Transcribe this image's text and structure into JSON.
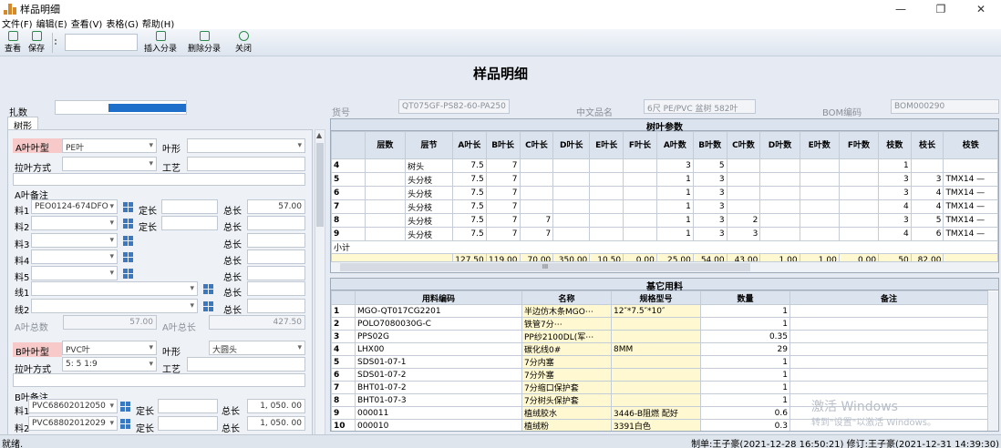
{
  "window": {
    "title": "样品明细",
    "min": "—",
    "max": "❐",
    "close": "✕"
  },
  "menu": [
    "文件(F)",
    "编辑(E)",
    "查看(V)",
    "表格(G)",
    "帮助(H)"
  ],
  "toolbar": {
    "view": "查看",
    "save": "保存",
    "insert": "插入分录",
    "delete": "删除分录",
    "close": "关闭"
  },
  "page_title": "样品明细",
  "header": {
    "bundle_label": "扎数",
    "item_no_label": "货号",
    "item_no": "QT075GF-PS82-60-PA250",
    "cn_name_label": "中文品名",
    "cn_name": "6尺 PE/PVC 盆树 582叶",
    "bom_label": "BOM编码",
    "bom": "BOM000290"
  },
  "left": {
    "tab": "树形",
    "a_type_label": "A叶叶型",
    "a_type": "PE叶",
    "shape_label": "叶形",
    "pull_label": "拉叶方式",
    "craft_label": "工艺",
    "a_note_label": "A叶备注",
    "mat1_label": "料1",
    "mat1": "PEO0124-674DFO",
    "fix_label": "定长",
    "total_label": "总长",
    "mat1_total": "57.00",
    "mat2_label": "料2",
    "mat3_label": "料3",
    "mat4_label": "料4",
    "mat5_label": "料5",
    "wire1_label": "线1",
    "wire2_label": "线2",
    "a_sum_label": "A叶总数",
    "a_sum": "57.00",
    "a_total_label": "A叶总长",
    "a_total": "427.50",
    "b_type_label": "B叶叶型",
    "b_type": "PVC叶",
    "b_shape_label": "叶形",
    "b_shape": "大圆头",
    "b_pull_label": "拉叶方式",
    "b_pull": "5: 5   1:9",
    "b_craft_label": "工艺",
    "b_note_label": "B叶备注",
    "b_mat1_label": "料1",
    "b_mat1": "PVC68602012050",
    "b_fix1_label": "定长",
    "b_total1_label": "总长",
    "b_total1": "1, 050. 00",
    "b_mat2_label": "料2",
    "b_mat2": "PVC68802012029",
    "b_fix2_label": "定长",
    "b_total2_label": "总长",
    "b_total2": "1, 050. 00"
  },
  "tree_params": {
    "caption": "树叶参数",
    "headers": [
      "层数",
      "层节",
      "A叶长",
      "B叶长",
      "C叶长",
      "D叶长",
      "E叶长",
      "F叶长",
      "A叶数",
      "B叶数",
      "C叶数",
      "D叶数",
      "E叶数",
      "F叶数",
      "枝数",
      "枝长",
      "枝铁"
    ],
    "rows": [
      {
        "rn": "4",
        "node": "树头",
        "a": "7.5",
        "b": "7",
        "c": "",
        "an": "3",
        "bn": "5",
        "cn": "",
        "zs": "1",
        "zc": "",
        "zt": ""
      },
      {
        "rn": "5",
        "node": "头分枝",
        "a": "7.5",
        "b": "7",
        "c": "",
        "an": "1",
        "bn": "3",
        "cn": "",
        "zs": "3",
        "zc": "3",
        "zt": "TMX14 —"
      },
      {
        "rn": "6",
        "node": "头分枝",
        "a": "7.5",
        "b": "7",
        "c": "",
        "an": "1",
        "bn": "3",
        "cn": "",
        "zs": "3",
        "zc": "4",
        "zt": "TMX14 —"
      },
      {
        "rn": "7",
        "node": "头分枝",
        "a": "7.5",
        "b": "7",
        "c": "",
        "an": "1",
        "bn": "3",
        "cn": "",
        "zs": "4",
        "zc": "4",
        "zt": "TMX14 —"
      },
      {
        "rn": "8",
        "node": "头分枝",
        "a": "7.5",
        "b": "7",
        "c": "7",
        "an": "1",
        "bn": "3",
        "cn": "2",
        "zs": "3",
        "zc": "5",
        "zt": "TMX14 —"
      },
      {
        "rn": "9",
        "node": "头分枝",
        "a": "7.5",
        "b": "7",
        "c": "7",
        "an": "1",
        "bn": "3",
        "cn": "3",
        "zs": "4",
        "zc": "6",
        "zt": "TMX14 —"
      }
    ],
    "subtotal_label": "小计",
    "totals": [
      "127.50",
      "119.00",
      "70.00",
      "350.00",
      "10.50",
      "0.00",
      "25.00",
      "54.00",
      "43.00",
      "1.00",
      "1.00",
      "0.00",
      "50",
      "82.00"
    ]
  },
  "base_materials": {
    "caption": "基它用料",
    "headers": [
      "用料编码",
      "名称",
      "规格型号",
      "数量",
      "备注"
    ],
    "rows": [
      {
        "rn": "1",
        "code": "MGO-QT017CG2201",
        "name": "半边仿木条MGO⋯",
        "spec": "12″*7.5″*10″",
        "qty": "1"
      },
      {
        "rn": "2",
        "code": "POLO7080030G-C",
        "name": "铁管7分⋯",
        "spec": "",
        "qty": "1"
      },
      {
        "rn": "3",
        "code": "PPS02G",
        "name": "PP纱2100DL(军⋯",
        "spec": "",
        "qty": "0.35"
      },
      {
        "rn": "4",
        "code": "LHX00",
        "name": "碳化线0#",
        "spec": "8MM",
        "qty": "29"
      },
      {
        "rn": "5",
        "code": "SDS01-07-1",
        "name": "7分内塞",
        "spec": "",
        "qty": "1"
      },
      {
        "rn": "6",
        "code": "SDS01-07-2",
        "name": "7分外塞",
        "spec": "",
        "qty": "1"
      },
      {
        "rn": "7",
        "code": "BHT01-07-2",
        "name": "7分缩口保护套",
        "spec": "",
        "qty": "1"
      },
      {
        "rn": "8",
        "code": "BHT01-07-3",
        "name": "7分树头保护套",
        "spec": "",
        "qty": "1"
      },
      {
        "rn": "9",
        "code": "000011",
        "name": "植绒胶水",
        "spec": "3446-B阻燃 配好",
        "qty": "0.6"
      },
      {
        "rn": "10",
        "code": "000010",
        "name": "植绒粉",
        "spec": "3391白色",
        "qty": "0.3"
      }
    ]
  },
  "watermark": {
    "line1": "激活 Windows",
    "line2": "转到\"设置\"以激活 Windows。"
  },
  "status": {
    "left": "就绪.",
    "right": "制单:王子豪(2021-12-28 16:50:21) 修订:王子豪(2021-12-31 14:39:30)"
  }
}
